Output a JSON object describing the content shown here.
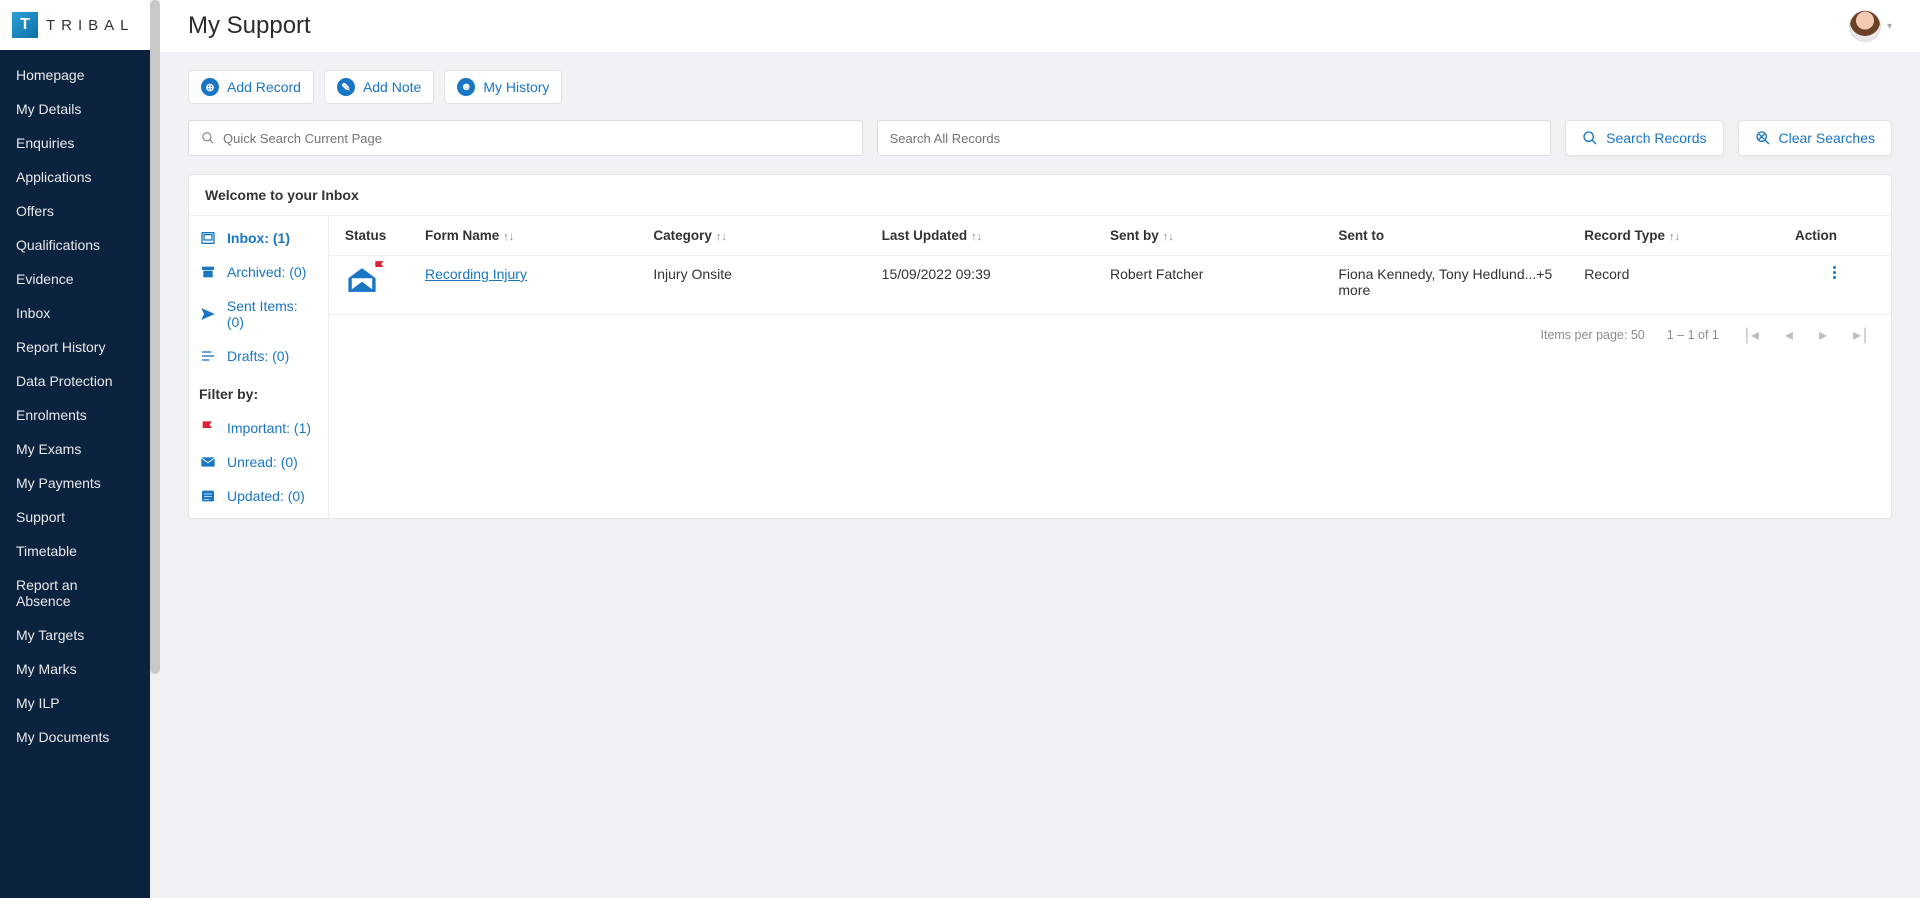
{
  "brand": {
    "mark": "T",
    "name": "TRIBAL"
  },
  "nav": [
    "Homepage",
    "My Details",
    "Enquiries",
    "Applications",
    "Offers",
    "Qualifications",
    "Evidence",
    "Inbox",
    "Report History",
    "Data Protection",
    "Enrolments",
    "My Exams",
    "My Payments",
    "Support",
    "Timetable",
    "Report an Absence",
    "My Targets",
    "My Marks",
    "My ILP",
    "My Documents"
  ],
  "header": {
    "title": "My Support"
  },
  "toolbar": {
    "add_record": "Add Record",
    "add_note": "Add Note",
    "my_history": "My History"
  },
  "search": {
    "quick_placeholder": "Quick Search Current Page",
    "all_placeholder": "Search All Records",
    "search_btn": "Search Records",
    "clear_btn": "Clear Searches"
  },
  "panel": {
    "heading": "Welcome to your Inbox"
  },
  "folders": {
    "inbox": "Inbox: (1)",
    "archived": "Archived: (0)",
    "sent": "Sent Items: (0)",
    "drafts": "Drafts: (0)",
    "filter_label": "Filter by:",
    "important": "Important: (1)",
    "unread": "Unread: (0)",
    "updated": "Updated: (0)"
  },
  "grid": {
    "columns": {
      "status": "Status",
      "form_name": "Form Name",
      "category": "Category",
      "last_updated": "Last Updated",
      "sent_by": "Sent by",
      "sent_to": "Sent to",
      "record_type": "Record Type",
      "action": "Action"
    },
    "rows": [
      {
        "form_name": "Recording Injury",
        "category": "Injury Onsite",
        "last_updated": "15/09/2022 09:39",
        "sent_by": "Robert Fatcher",
        "sent_to": "Fiona Kennedy, Tony Hedlund...+5 more",
        "record_type": "Record"
      }
    ]
  },
  "paginator": {
    "items_per_page_label": "Items per page:",
    "items_per_page_value": "50",
    "range": "1 – 1 of 1"
  }
}
